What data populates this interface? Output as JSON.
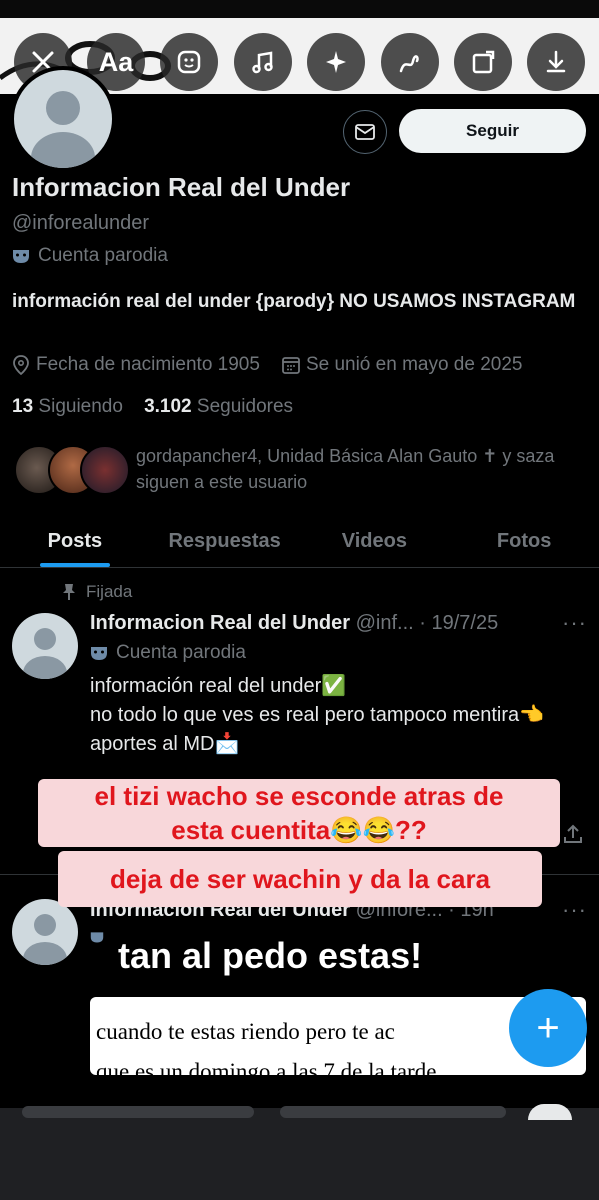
{
  "toolbar": {
    "buttons": [
      "close-icon",
      "text-icon",
      "sticker-icon",
      "music-icon",
      "sparkle-icon",
      "draw-icon",
      "crop-icon",
      "download-icon"
    ],
    "text_label": "Aa"
  },
  "profile": {
    "message_icon": "envelope-icon",
    "follow_label": "Seguir",
    "name": "Informacion Real del Under",
    "handle": "@inforealunder",
    "parody_label": "Cuenta parodia",
    "bio": "información real del under {parody} NO USAMOS INSTAGRAM",
    "birth": "Fecha de nacimiento 1905",
    "joined": "Se unió en mayo de 2025",
    "following_count": "13",
    "following_label": "Siguiendo",
    "followers_count": "3.102",
    "followers_label": "Seguidores",
    "followed_by": "gordapancher4, Unidad Básica Alan Gauto ✝ y saza siguen a este usuario"
  },
  "tabs": [
    "Posts",
    "Respuestas",
    "Videos",
    "Fotos"
  ],
  "post1": {
    "pinned_label": "Fijada",
    "name": "Informacion Real del Under",
    "meta": "@inf... · 19/7/25",
    "more": "···",
    "parody_label": "Cuenta parodia",
    "line1": "información real del under✅",
    "line2": "no todo lo que ves es real pero tampoco mentira👈",
    "line3": "aportes al MD📩"
  },
  "overlay": {
    "line1": "el tizi wacho se esconde atras de",
    "line2": "esta cuentita😂😂??",
    "line3": "deja de ser wachin y da la cara",
    "line4": "tan al pedo estas!"
  },
  "post2": {
    "name": "Informacion Real del Under",
    "meta": "@infore... · 19h",
    "more": "···",
    "meme_text": "cuando te estas riendo pero te ac",
    "meme_text2": "que es un domingo a las 7 de la tarde"
  },
  "fab_label": "+"
}
